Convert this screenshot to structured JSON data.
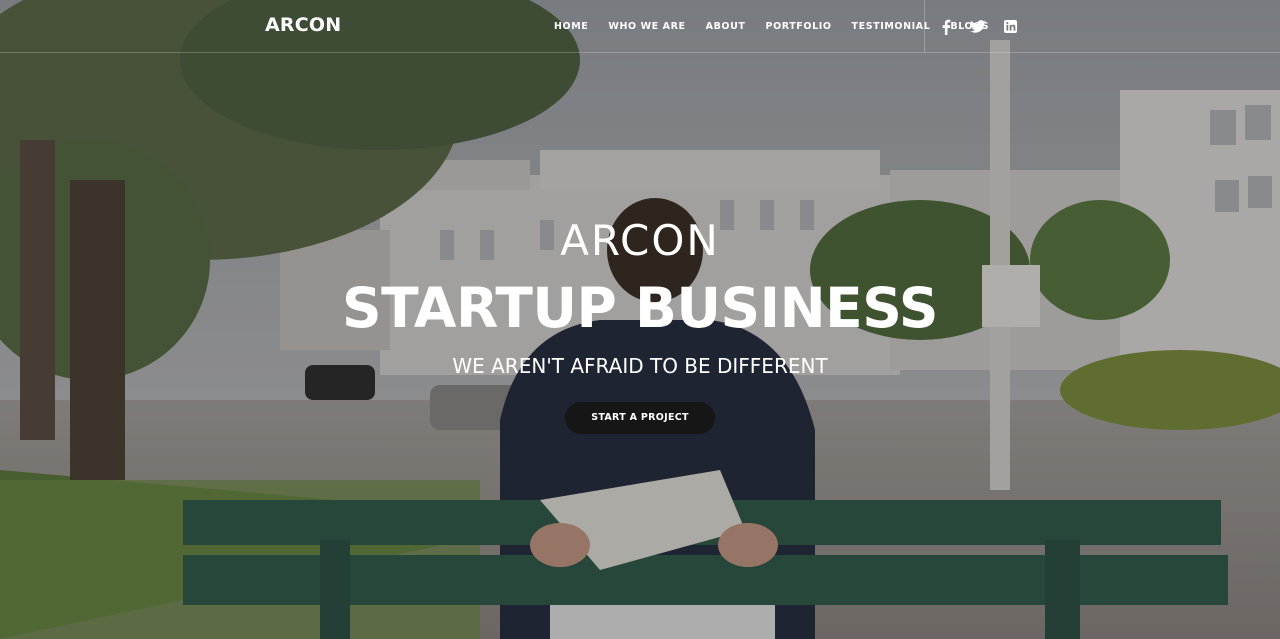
{
  "header": {
    "logo": "ARCON",
    "nav": [
      {
        "label": "HOME"
      },
      {
        "label": "WHO WE ARE"
      },
      {
        "label": "ABOUT"
      },
      {
        "label": "PORTFOLIO"
      },
      {
        "label": "TESTIMONIAL"
      },
      {
        "label": "BLOGS"
      }
    ],
    "social": [
      {
        "icon": "facebook-icon"
      },
      {
        "icon": "twitter-icon"
      },
      {
        "icon": "linkedin-icon"
      }
    ]
  },
  "hero": {
    "brand": "ARCON",
    "title": "STARTUP BUSINESS",
    "tagline": "WE AREN'T AFRAID TO BE DIFFERENT",
    "cta_label": "START A PROJECT"
  },
  "colors": {
    "text": "#ffffff",
    "cta_background": "#161616"
  }
}
